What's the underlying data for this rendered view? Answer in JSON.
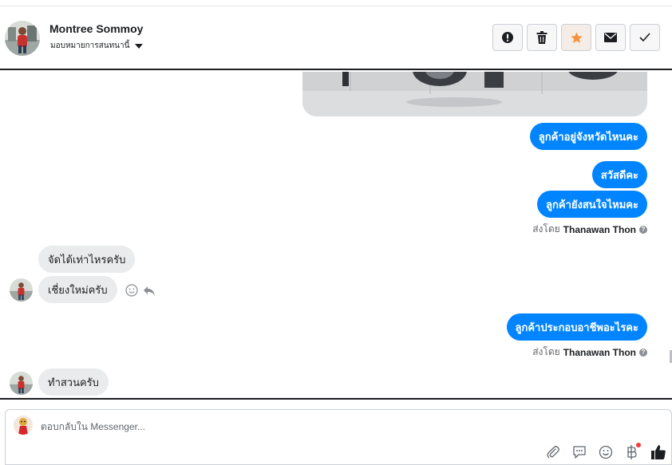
{
  "header": {
    "contact_name": "Montree Sommoy",
    "assign_label": "มอบหมายการสนทนานี้",
    "actions": [
      {
        "name": "spam-button",
        "icon": "exclamation-icon"
      },
      {
        "name": "delete-button",
        "icon": "trash-icon"
      },
      {
        "name": "follow-up-button",
        "icon": "star-icon"
      },
      {
        "name": "mark-unread-button",
        "icon": "envelope-icon"
      },
      {
        "name": "mark-done-button",
        "icon": "check-icon"
      }
    ]
  },
  "thread": {
    "messages": [
      {
        "direction": "out",
        "text": "ลูกค้าอยู่จังหวัดไหนคะ"
      },
      {
        "direction": "out",
        "text": "สวัสดีคะ"
      },
      {
        "direction": "out",
        "text": "ลูกค้ายังสนใจไหมคะ"
      },
      {
        "direction": "in",
        "text": "จัดได้เท่าไหรครับ"
      },
      {
        "direction": "in",
        "text": "เชี่ยงใหม่ครับ"
      },
      {
        "direction": "out",
        "text": "ลูกค้าประกอบอาชีพอะไรคะ"
      },
      {
        "direction": "in",
        "text": "ทำสวนครับ"
      }
    ],
    "sent_by_prefix": "ส่งโดย",
    "sent_by_agent": "Thanawan Thon"
  },
  "composer": {
    "placeholder": "ตอบกลับใน Messenger..."
  },
  "colors": {
    "outgoing_bubble": "#0084ff",
    "incoming_bubble": "#eaebed",
    "follow_up_star": "#f7923b",
    "notification_dot": "#fa383e"
  }
}
